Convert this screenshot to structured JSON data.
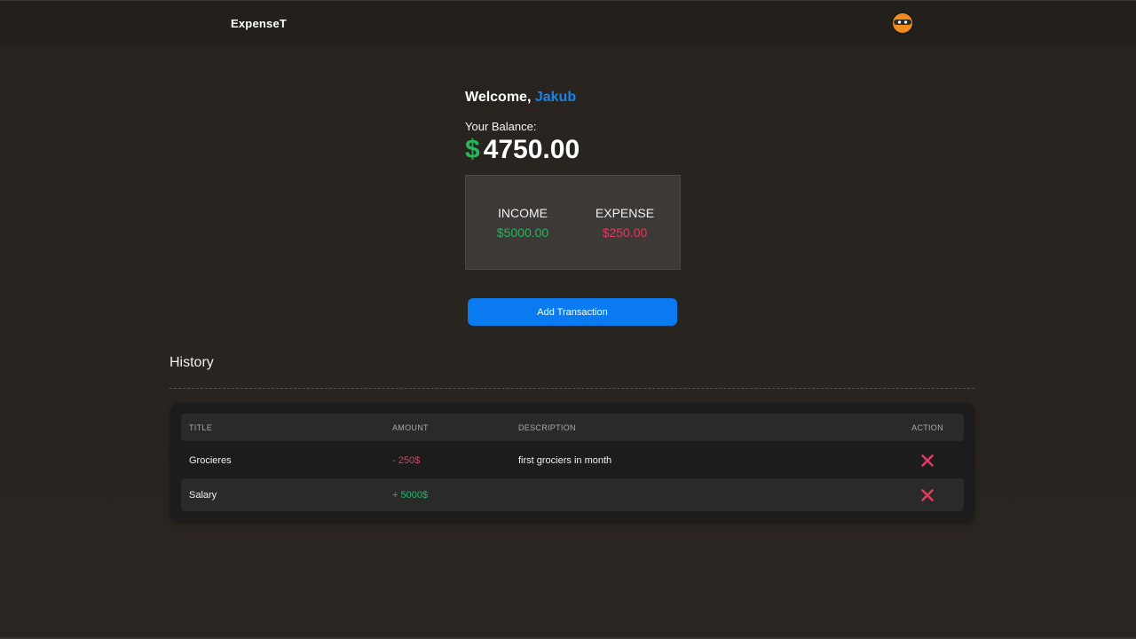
{
  "navbar": {
    "brand": "ExpenseT",
    "avatar_icon": "ninja-avatar-icon"
  },
  "dashboard": {
    "welcome_prefix": "Welcome, ",
    "user_name": "Jakub",
    "balance_label": "Your Balance:",
    "currency_symbol": "$",
    "balance_value": "4750.00",
    "income_label": "INCOME",
    "income_value": "$5000.00",
    "expense_label": "EXPENSE",
    "expense_value": "$250.00",
    "add_button_label": "Add Transaction"
  },
  "history": {
    "title": "History",
    "columns": [
      "TITLE",
      "AMOUNT",
      "DESCRIPTION",
      "ACTION"
    ],
    "rows": [
      {
        "title": "Grocieres",
        "amount": "- 250$",
        "description": "first grociers in month",
        "action_icon": "close-icon"
      },
      {
        "title": "Salary",
        "amount": "+ 5000$",
        "description": "",
        "action_icon": "close-icon"
      }
    ]
  },
  "colors": {
    "background": "#28241f",
    "accent_blue": "#0a7af0",
    "income_green": "#23b85e",
    "expense_red": "#e5385d"
  }
}
